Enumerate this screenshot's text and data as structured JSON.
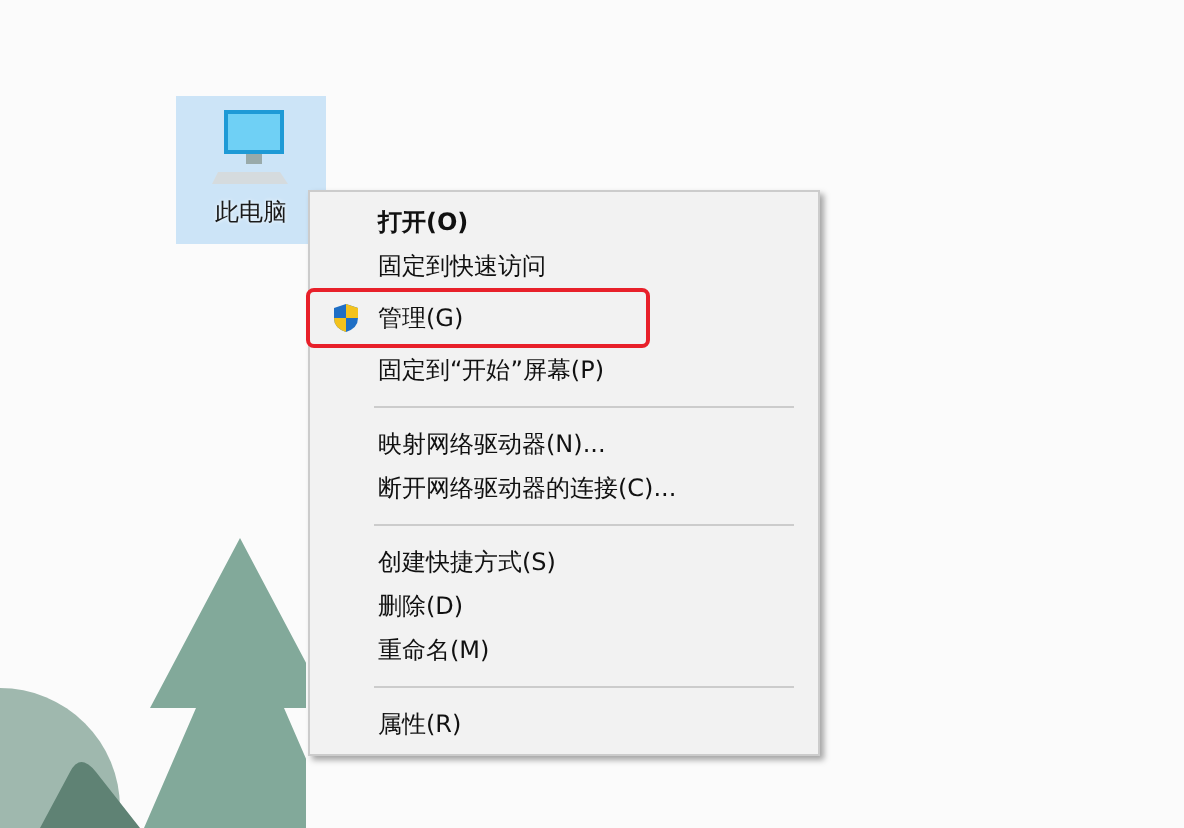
{
  "desktop_icon": {
    "label": "此电脑",
    "selected": true
  },
  "context_menu": {
    "items": [
      {
        "kind": "item",
        "label": "打开(O)",
        "bold": true,
        "shield": false,
        "marked": false
      },
      {
        "kind": "item",
        "label": "固定到快速访问",
        "bold": false,
        "shield": false,
        "marked": false
      },
      {
        "kind": "item",
        "label": "管理(G)",
        "bold": false,
        "shield": true,
        "marked": true
      },
      {
        "kind": "item",
        "label": "固定到“开始”屏幕(P)",
        "bold": false,
        "shield": false,
        "marked": false
      },
      {
        "kind": "separator"
      },
      {
        "kind": "item",
        "label": "映射网络驱动器(N)...",
        "bold": false,
        "shield": false,
        "marked": false
      },
      {
        "kind": "item",
        "label": "断开网络驱动器的连接(C)...",
        "bold": false,
        "shield": false,
        "marked": false
      },
      {
        "kind": "separator"
      },
      {
        "kind": "item",
        "label": "创建快捷方式(S)",
        "bold": false,
        "shield": false,
        "marked": false
      },
      {
        "kind": "item",
        "label": "删除(D)",
        "bold": false,
        "shield": false,
        "marked": false
      },
      {
        "kind": "item",
        "label": "重命名(M)",
        "bold": false,
        "shield": false,
        "marked": false
      },
      {
        "kind": "separator"
      },
      {
        "kind": "item",
        "label": "属性(R)",
        "bold": false,
        "shield": false,
        "marked": false
      }
    ]
  }
}
